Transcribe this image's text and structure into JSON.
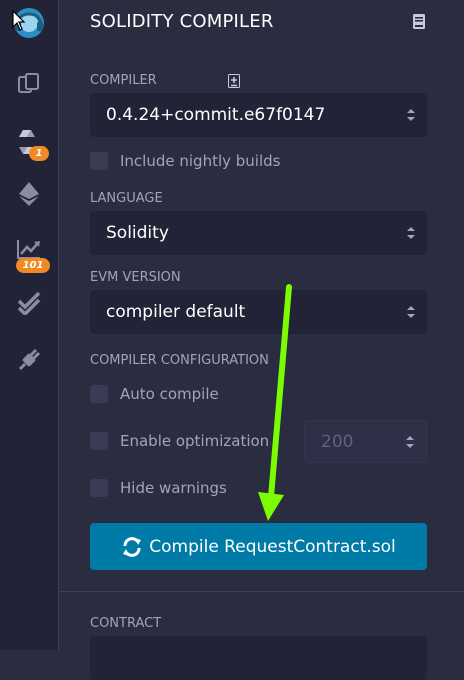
{
  "iconbar": {
    "items": [
      {
        "icon": "remix-logo-icon"
      },
      {
        "icon": "file-explorer-icon"
      },
      {
        "icon": "solidity-compiler-icon",
        "badge": "1"
      },
      {
        "icon": "deploy-run-icon"
      },
      {
        "icon": "analysis-icon",
        "badge": "101"
      },
      {
        "icon": "testing-icon"
      },
      {
        "icon": "plugin-manager-icon"
      }
    ]
  },
  "panel": {
    "title": "SOLIDITY COMPILER",
    "compiler_label": "COMPILER",
    "compiler_value": "0.4.24+commit.e67f0147",
    "nightly_label": "Include nightly builds",
    "language_label": "LANGUAGE",
    "language_value": "Solidity",
    "evm_label": "EVM VERSION",
    "evm_value": "compiler default",
    "config_label": "COMPILER CONFIGURATION",
    "auto_compile_label": "Auto compile",
    "optimization_label": "Enable optimization",
    "runs_value": "200",
    "hide_warnings_label": "Hide warnings",
    "compile_button_label": "Compile RequestContract.sol",
    "contract_label": "CONTRACT"
  },
  "colors": {
    "background": "#2a2c3f",
    "iconbar": "#222336",
    "accent": "#007aa6",
    "badge": "#f08a24",
    "annotation_arrow": "#7cfc00"
  }
}
